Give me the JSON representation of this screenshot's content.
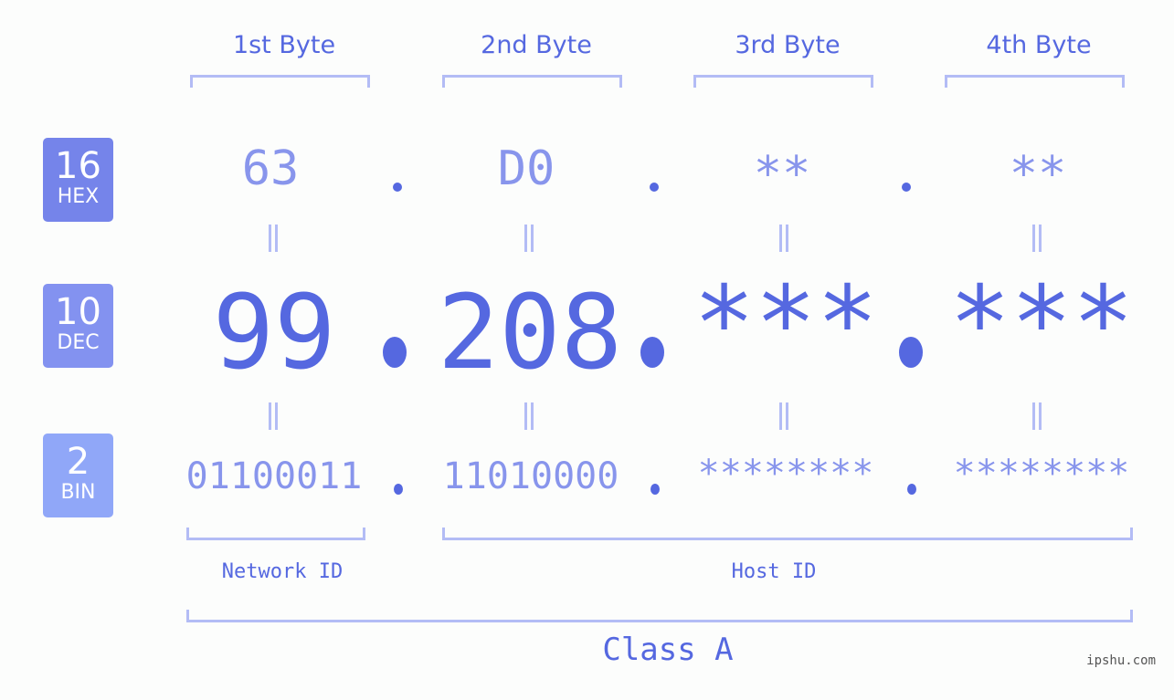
{
  "badges": [
    {
      "base": "16",
      "label": "HEX",
      "color": "#7584ea"
    },
    {
      "base": "10",
      "label": "DEC",
      "color": "#8392f0"
    },
    {
      "base": "2",
      "label": "BIN",
      "color": "#90a7f8"
    }
  ],
  "byte_headers": [
    "1st Byte",
    "2nd Byte",
    "3rd Byte",
    "4th Byte"
  ],
  "hex": [
    "63",
    "D0",
    "**",
    "**"
  ],
  "dec": [
    "99",
    "208",
    "***",
    "***"
  ],
  "bin": [
    "01100011",
    "11010000",
    "********",
    "********"
  ],
  "network_label": "Network ID",
  "host_label": "Host ID",
  "class_label": "Class A",
  "brand": "ipshu.com",
  "colors": {
    "accent": "#5568e0",
    "light": "#8895ec",
    "bracket": "#b3bcf5"
  }
}
